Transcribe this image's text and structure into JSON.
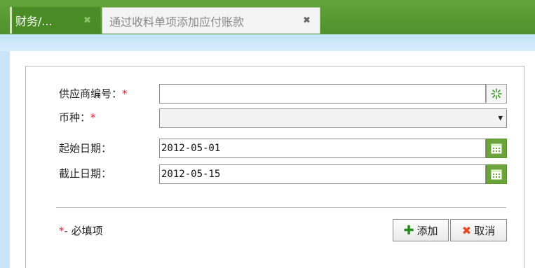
{
  "tabs": [
    {
      "label": "财务/...",
      "close": "✖"
    },
    {
      "label": "通过收料单项添加应付账款",
      "close": "✖"
    }
  ],
  "form": {
    "supplier": {
      "label": "供应商编号：",
      "required_mark": "*",
      "value": ""
    },
    "currency": {
      "label": "币种：",
      "required_mark": "*",
      "value": ""
    },
    "start_date": {
      "label": "起始日期：",
      "value": "2012-05-01"
    },
    "end_date": {
      "label": "截止日期：",
      "value": "2012-05-15"
    }
  },
  "legend": {
    "mark": "*",
    "text": "- 必填项"
  },
  "buttons": {
    "add_label": "添加",
    "cancel_label": "取消"
  },
  "icons": {
    "supplier_picker": "sparkle-picker-icon",
    "calendar": "calendar-icon",
    "add": "plus-icon",
    "cancel": "x-icon"
  },
  "colors": {
    "tabbar_green": "#4f912b",
    "calendar_green": "#6aa43a",
    "required_red": "#e22233"
  }
}
